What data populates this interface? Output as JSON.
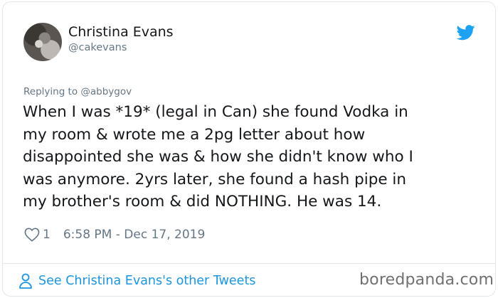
{
  "author": {
    "name": "Christina Evans",
    "handle": "@cakevans"
  },
  "reply": {
    "text": "Replying to @abbygov"
  },
  "tweet": {
    "lines": [
      "When I was *19* (legal in Can) she found Vodka in",
      "my room & wrote me a 2pg letter about how",
      "disappointed she was & how she didn't know who I",
      "was anymore. 2yrs later, she found a hash pipe in",
      "my brother's room & did NOTHING. He was 14."
    ]
  },
  "meta": {
    "likes": "1",
    "timestamp": "6:58 PM - Dec 17, 2019"
  },
  "footer": {
    "see_more": "See Christina Evans's other Tweets"
  },
  "watermark": {
    "text": "boredpanda.com"
  },
  "icons": {
    "brand": "twitter-bird-icon",
    "like": "heart-icon",
    "profile": "person-icon"
  },
  "colors": {
    "twitter_blue": "#1da1f2",
    "link_blue": "#1b95e0",
    "muted_gray": "#657786",
    "border": "#e1e8ed"
  }
}
